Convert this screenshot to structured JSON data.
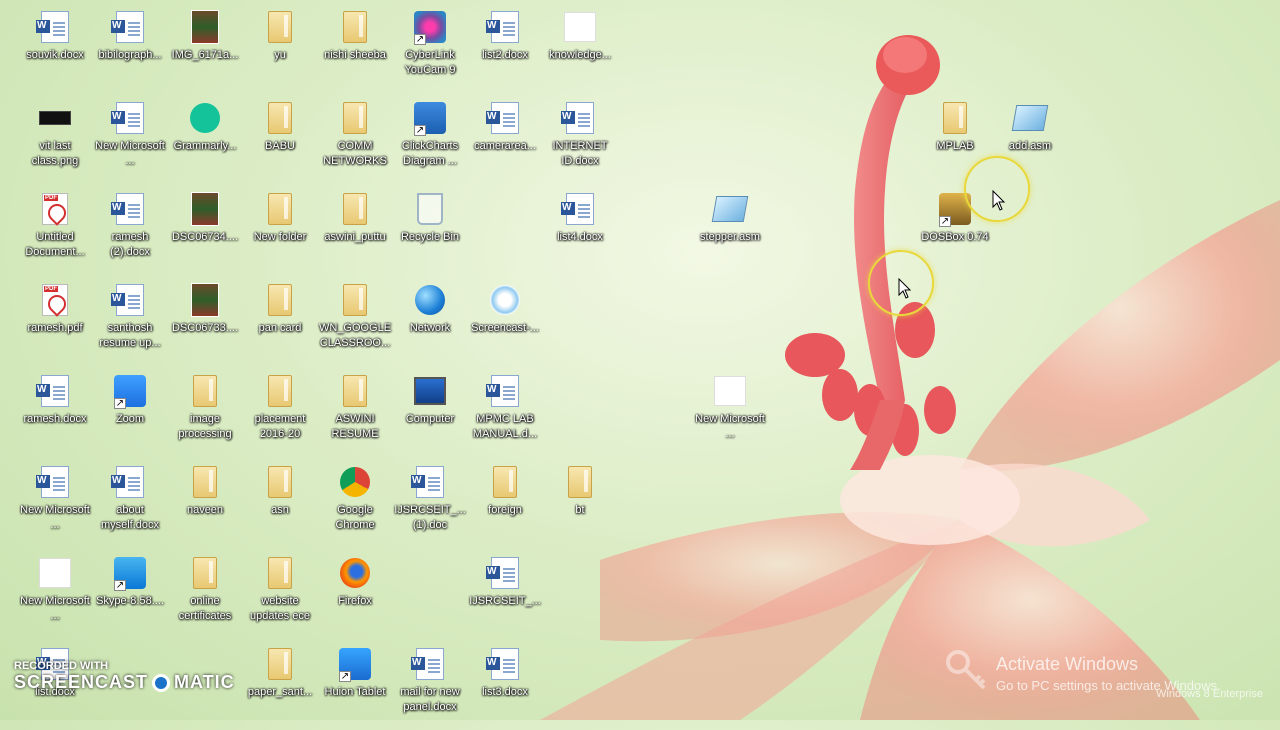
{
  "icons": [
    {
      "label": "souvik.docx",
      "type": "word"
    },
    {
      "label": "bibilograph...",
      "type": "word"
    },
    {
      "label": "IMG_6171a...",
      "type": "photo"
    },
    {
      "label": "yu",
      "type": "folder"
    },
    {
      "label": "nishi sheeba",
      "type": "folder"
    },
    {
      "label": "CyberLink YouCam 9",
      "type": "app"
    },
    {
      "label": "list2.docx",
      "type": "word"
    },
    {
      "label": "knowledge...",
      "type": "blank"
    },
    {
      "label": "vit last class.png",
      "type": "black"
    },
    {
      "label": "New Microsoft ...",
      "type": "word"
    },
    {
      "label": "Grammarly...",
      "type": "round"
    },
    {
      "label": "BABU",
      "type": "folder"
    },
    {
      "label": "COMM NETWORKS",
      "type": "folder"
    },
    {
      "label": "ClickCharts Diagram ...",
      "type": "app"
    },
    {
      "label": "camerarea...",
      "type": "word"
    },
    {
      "label": "INTERNET ID.docx",
      "type": "word"
    },
    {
      "label": "MPLAB",
      "type": "folder"
    },
    {
      "label": "add.asm",
      "type": "asm"
    },
    {
      "label": "Untitled Document...",
      "type": "pdf"
    },
    {
      "label": "ramesh (2).docx",
      "type": "word"
    },
    {
      "label": "DSC06734....",
      "type": "photo"
    },
    {
      "label": "New folder",
      "type": "folder"
    },
    {
      "label": "aswini_puttu",
      "type": "folder"
    },
    {
      "label": "Recycle Bin",
      "type": "bin"
    },
    {
      "label": "list4.docx",
      "type": "word"
    },
    {
      "label": "stepper.asm",
      "type": "asm"
    },
    {
      "label": "DOSBox 0.74",
      "type": "app"
    },
    {
      "label": "ramesh.pdf",
      "type": "pdf"
    },
    {
      "label": "santhosh resume up...",
      "type": "word"
    },
    {
      "label": "DSC06733....",
      "type": "photo"
    },
    {
      "label": "pan card",
      "type": "folder"
    },
    {
      "label": "WN_GOOGLE CLASSROO...",
      "type": "folder"
    },
    {
      "label": "Network",
      "type": "round"
    },
    {
      "label": "Screencast-...",
      "type": "round"
    },
    {
      "label": "ramesh.docx",
      "type": "word"
    },
    {
      "label": "Zoom",
      "type": "app"
    },
    {
      "label": "image processing",
      "type": "folder"
    },
    {
      "label": "placement 2016-20",
      "type": "folder"
    },
    {
      "label": "ASWINI RESUME",
      "type": "folder"
    },
    {
      "label": "Computer",
      "type": "monitor"
    },
    {
      "label": "MPMC LAB MANUAL.d...",
      "type": "word"
    },
    {
      "label": "New Microsoft ...",
      "type": "blank"
    },
    {
      "label": "New Microsoft ...",
      "type": "word"
    },
    {
      "label": "about myself.docx",
      "type": "word"
    },
    {
      "label": "naveen",
      "type": "folder"
    },
    {
      "label": "asn",
      "type": "folder"
    },
    {
      "label": "Google Chrome",
      "type": "round"
    },
    {
      "label": "IJSRCSEIT_... (1).doc",
      "type": "word"
    },
    {
      "label": "foreign",
      "type": "folder"
    },
    {
      "label": "bt",
      "type": "folder"
    },
    {
      "label": "New Microsoft ...",
      "type": "blank"
    },
    {
      "label": "Skype-8.58....",
      "type": "app"
    },
    {
      "label": "online certificates",
      "type": "folder"
    },
    {
      "label": "website updates ece",
      "type": "folder"
    },
    {
      "label": "Firefox",
      "type": "round"
    },
    {
      "label": "IJSRCSEIT_...",
      "type": "word"
    },
    {
      "label": "list.docx",
      "type": "word"
    },
    {
      "label": "paper_sant...",
      "type": "folder"
    },
    {
      "label": "Huion Tablet",
      "type": "app"
    },
    {
      "label": "mail for new panel.docx",
      "type": "word"
    },
    {
      "label": "list3.docx",
      "type": "word"
    }
  ],
  "watermark": {
    "line1": "RECORDED WITH",
    "line2a": "SCREENCAST",
    "line2b": "MATIC"
  },
  "activation": {
    "title": "Activate Windows",
    "subtitle": "Go to PC settings to activate Windows.",
    "edition": "Windows 8 Enterprise"
  }
}
